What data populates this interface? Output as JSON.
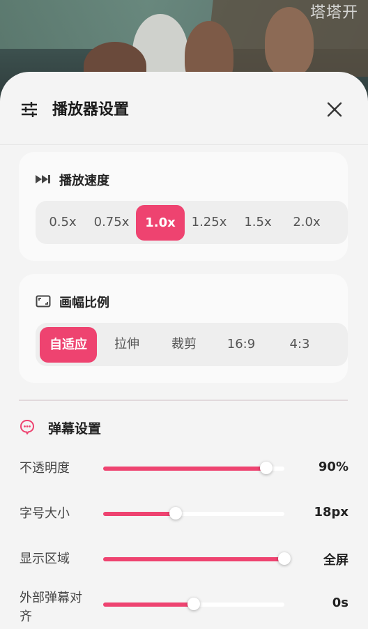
{
  "watermark": "塔塔开",
  "header": {
    "title": "播放器设置"
  },
  "speed": {
    "title": "播放速度",
    "options": [
      "0.5x",
      "0.75x",
      "1.0x",
      "1.25x",
      "1.5x",
      "2.0x"
    ],
    "selected": "1.0x"
  },
  "aspect": {
    "title": "画幅比例",
    "options": [
      "自适应",
      "拉伸",
      "裁剪",
      "16:9",
      "4:3"
    ],
    "selected": "自适应"
  },
  "danmu": {
    "title": "弹幕设置",
    "rows": [
      {
        "label": "不透明度",
        "value": "90%",
        "fraction": 0.9
      },
      {
        "label": "字号大小",
        "value": "18px",
        "fraction": 0.4
      },
      {
        "label": "显示区域",
        "value": "全屏",
        "fraction": 1.0
      },
      {
        "label": "外部弹幕对齐",
        "value": "0s",
        "fraction": 0.5
      }
    ]
  },
  "colors": {
    "accent": "#ee4370"
  },
  "icons": {
    "menu": "sliders-icon",
    "close": "close-icon",
    "speed": "fast-forward-icon",
    "aspect": "aspect-ratio-icon",
    "danmu": "comment-bubble-icon"
  }
}
